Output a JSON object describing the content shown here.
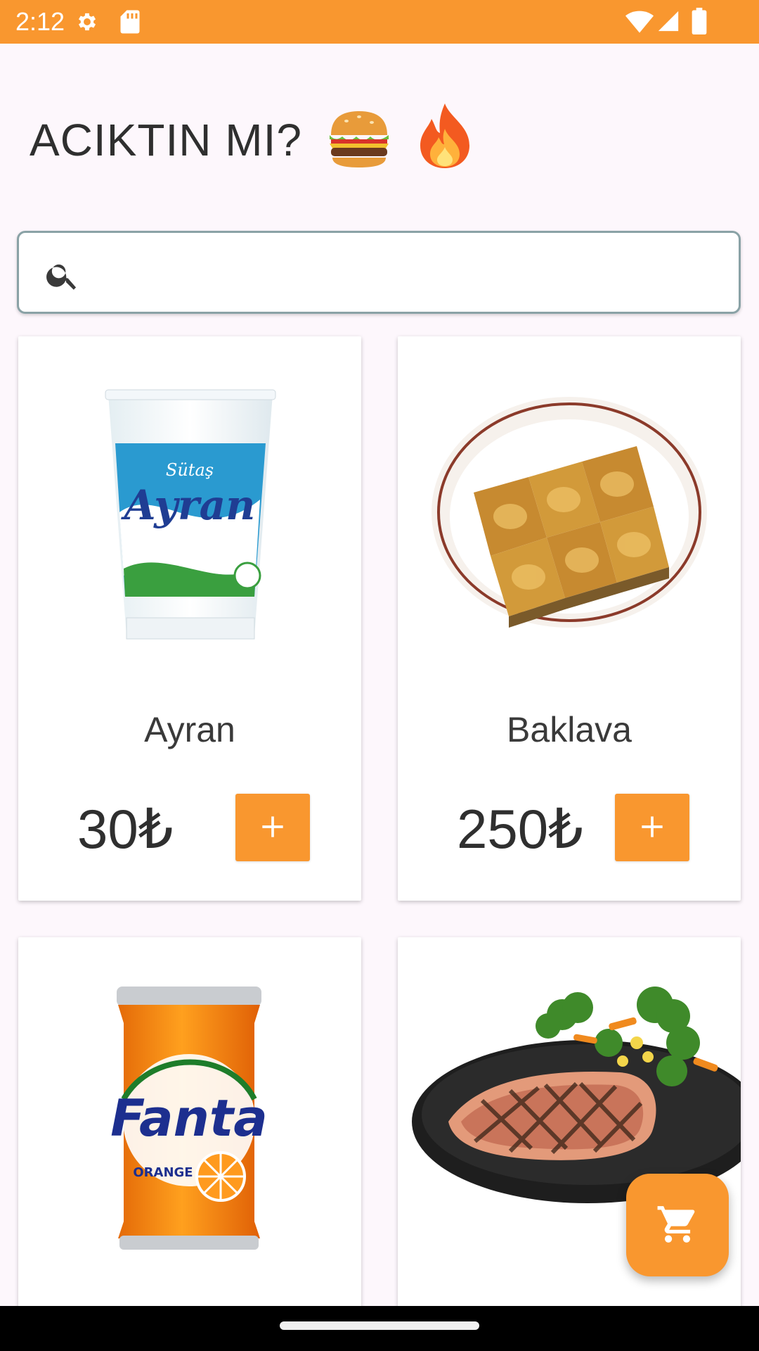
{
  "status_bar": {
    "time": "2:12",
    "icons": [
      "gear-icon",
      "sd-card-icon",
      "wifi-icon",
      "signal-icon",
      "battery-icon"
    ],
    "color": "#f9972f"
  },
  "title": {
    "text": "ACIKTIN MI?",
    "emojis": [
      "burger-icon",
      "fire-icon"
    ]
  },
  "search": {
    "placeholder": "",
    "value": "",
    "icon": "search-icon"
  },
  "products": [
    {
      "name": "Ayran",
      "price": "30₺",
      "image": "ayran-image"
    },
    {
      "name": "Baklava",
      "price": "250₺",
      "image": "baklava-image"
    },
    {
      "name": "",
      "price": "",
      "image": "fanta-image"
    },
    {
      "name": "",
      "price": "",
      "image": "salmon-image"
    }
  ],
  "add_button": {
    "icon": "plus-icon"
  },
  "cart_fab": {
    "icon": "cart-icon"
  },
  "accent_color": "#f9972f"
}
